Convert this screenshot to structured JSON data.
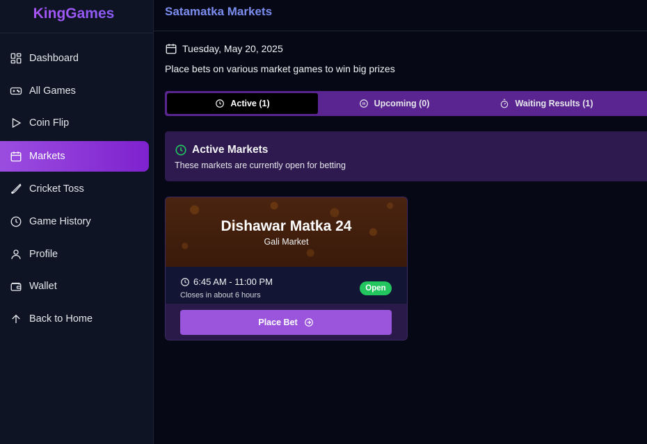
{
  "brand": "KingGames",
  "sidebar": {
    "items": [
      {
        "label": "Dashboard",
        "icon": "dashboard-icon"
      },
      {
        "label": "All Games",
        "icon": "gamepad-icon"
      },
      {
        "label": "Coin Flip",
        "icon": "play-icon"
      },
      {
        "label": "Markets",
        "icon": "calendar-icon",
        "active": true
      },
      {
        "label": "Cricket Toss",
        "icon": "bat-icon"
      },
      {
        "label": "Game History",
        "icon": "clock-icon"
      },
      {
        "label": "Profile",
        "icon": "user-icon"
      },
      {
        "label": "Wallet",
        "icon": "wallet-icon"
      },
      {
        "label": "Back to Home",
        "icon": "arrow-up-icon"
      }
    ]
  },
  "header": {
    "title": "Satamatka Markets"
  },
  "main": {
    "date": "Tuesday, May 20, 2025",
    "subtitle": "Place bets on various market games to win big prizes",
    "tabs": [
      {
        "label": "Active (1)",
        "icon": "clock-icon",
        "active": true
      },
      {
        "label": "Upcoming (0)",
        "icon": "pause-circle-icon"
      },
      {
        "label": "Waiting Results (1)",
        "icon": "timer-icon"
      }
    ],
    "info": {
      "title": "Active Markets",
      "description": "These markets are currently open for betting"
    },
    "market_card": {
      "name": "Dishawar Matka 24",
      "type": "Gali Market",
      "time": "6:45 AM - 11:00 PM",
      "closes": "Closes in about 6 hours",
      "status": "Open",
      "button": "Place Bet"
    }
  },
  "colors": {
    "accent": "#9b55dc",
    "header_title": "#7b8ef0",
    "status_open": "#22c55e",
    "active_icon": "#22c55e"
  }
}
